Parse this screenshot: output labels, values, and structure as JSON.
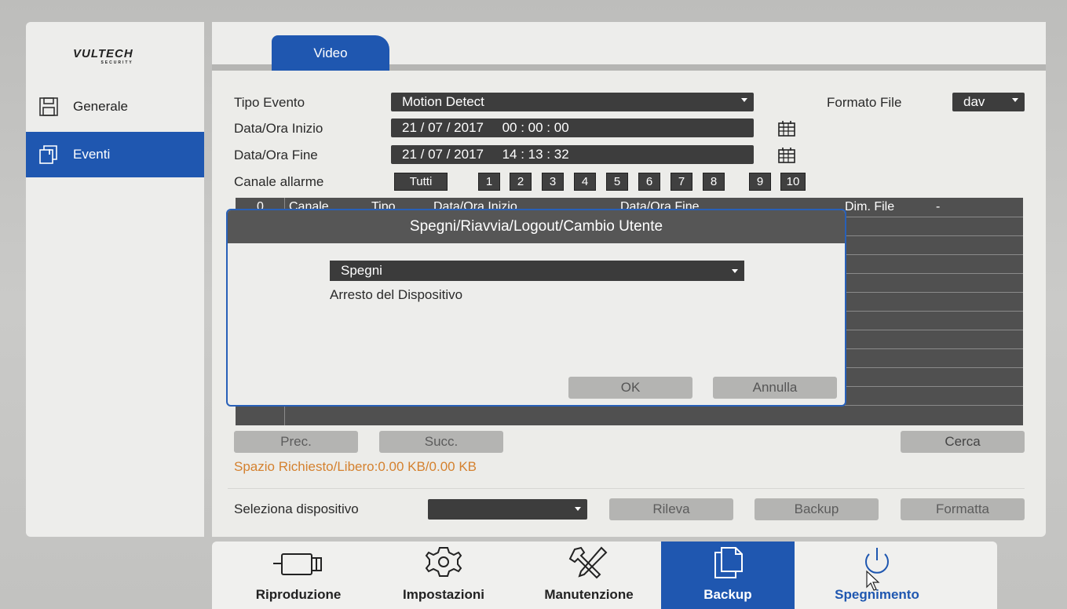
{
  "brand": {
    "logo": "VULTECH",
    "logo_sub": "SECURITY"
  },
  "sidebar": {
    "items": [
      {
        "label": "Generale",
        "icon": "save-icon",
        "active": false
      },
      {
        "label": "Eventi",
        "icon": "event-icon",
        "active": true
      }
    ]
  },
  "tabs": [
    {
      "label": "Video",
      "active": true
    }
  ],
  "form": {
    "tipo_evento_label": "Tipo Evento",
    "tipo_evento_value": "Motion Detect",
    "formato_file_label": "Formato File",
    "formato_file_value": "dav",
    "inizio_label": "Data/Ora Inizio",
    "inizio_value": "21 / 07 / 2017     00 : 00 : 00",
    "fine_label": "Data/Ora Fine",
    "fine_value": "21 / 07 / 2017     14 : 13 : 32",
    "canale_label": "Canale allarme",
    "tutti_label": "Tutti",
    "channels": [
      "1",
      "2",
      "3",
      "4",
      "5",
      "6",
      "7",
      "8",
      "9",
      "10"
    ]
  },
  "table": {
    "headers": [
      "0",
      "Canale",
      "Tipo",
      "Data/Ora Inizio",
      "Data/Ora Fine",
      "Dim. File"
    ],
    "sort_indicator": "-"
  },
  "nav_buttons": {
    "prev": "Prec.",
    "next": "Succ.",
    "search": "Cerca"
  },
  "space_text": "Spazio Richiesto/Libero:0.00 KB/0.00 KB",
  "device": {
    "label": "Seleziona dispositivo",
    "value": "",
    "detect": "Rileva",
    "backup": "Backup",
    "format": "Formatta"
  },
  "dialog": {
    "title": "Spegni/Riavvia/Logout/Cambio Utente",
    "select_value": "Spegni",
    "description": "Arresto del Dispositivo",
    "ok": "OK",
    "cancel": "Annulla"
  },
  "bottom_nav": [
    {
      "label": "Riproduzione",
      "icon": "camera-icon",
      "active": false
    },
    {
      "label": "Impostazioni",
      "icon": "gear-icon",
      "active": false
    },
    {
      "label": "Manutenzione",
      "icon": "tools-icon",
      "active": false
    },
    {
      "label": "Backup",
      "icon": "copy-icon",
      "active": true
    },
    {
      "label": "Spegnimento",
      "icon": "power-icon",
      "active": false,
      "hovered": true
    }
  ],
  "colors": {
    "accent": "#1f57b0",
    "warning_text": "#d4812f",
    "field_bg": "#3d3d3d"
  }
}
